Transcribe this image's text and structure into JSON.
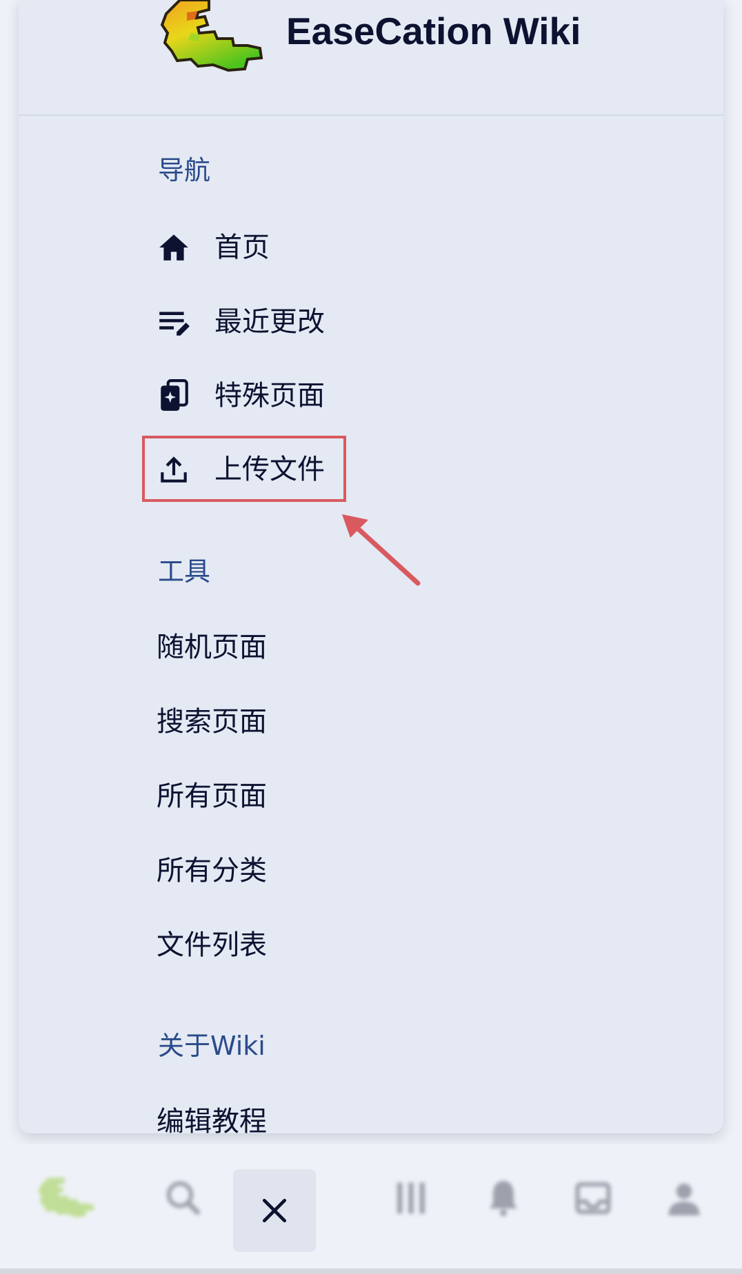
{
  "drawer": {
    "site_title": "EaseCation Wiki",
    "sections": [
      {
        "title": "导航",
        "items": [
          {
            "label": "首页",
            "icon": "home-icon"
          },
          {
            "label": "最近更改",
            "icon": "recent-changes-icon"
          },
          {
            "label": "特殊页面",
            "icon": "special-pages-icon"
          },
          {
            "label": "上传文件",
            "icon": "upload-icon"
          }
        ]
      },
      {
        "title": "工具",
        "items": [
          {
            "label": "随机页面"
          },
          {
            "label": "搜索页面"
          },
          {
            "label": "所有页面"
          },
          {
            "label": "所有分类"
          },
          {
            "label": "文件列表"
          }
        ]
      },
      {
        "title": "关于Wiki",
        "items": [
          {
            "label": "编辑教程"
          }
        ]
      }
    ]
  },
  "annotation": {
    "highlight_color": "#d85a5f",
    "highlighted_item": "上传文件"
  },
  "bottom_bar": {
    "items": [
      "logo",
      "search-icon",
      "close-icon",
      "tools-icon",
      "bell-icon",
      "inbox-icon",
      "user-icon"
    ]
  },
  "colors": {
    "title_text": "#0c1230",
    "section_heading": "#2a4a8a",
    "drawer_bg": "#e4e9f3"
  }
}
